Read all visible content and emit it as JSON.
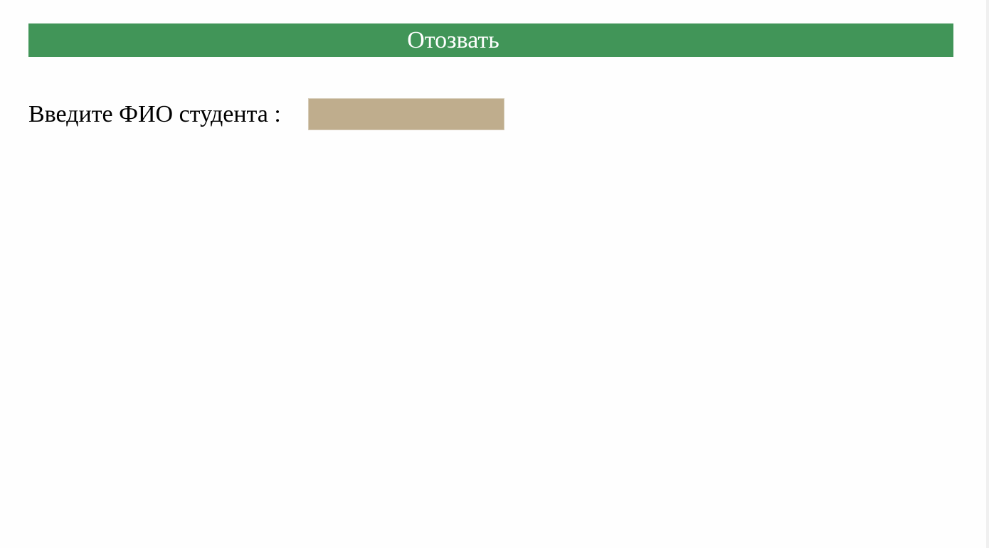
{
  "header": {
    "revoke_label": "Отозвать"
  },
  "form": {
    "student_name_label": "Введите ФИО студента :",
    "student_name_value": "",
    "student_name_placeholder": ""
  },
  "colors": {
    "header_bg": "#419558",
    "input_bg": "#bfad8d"
  }
}
